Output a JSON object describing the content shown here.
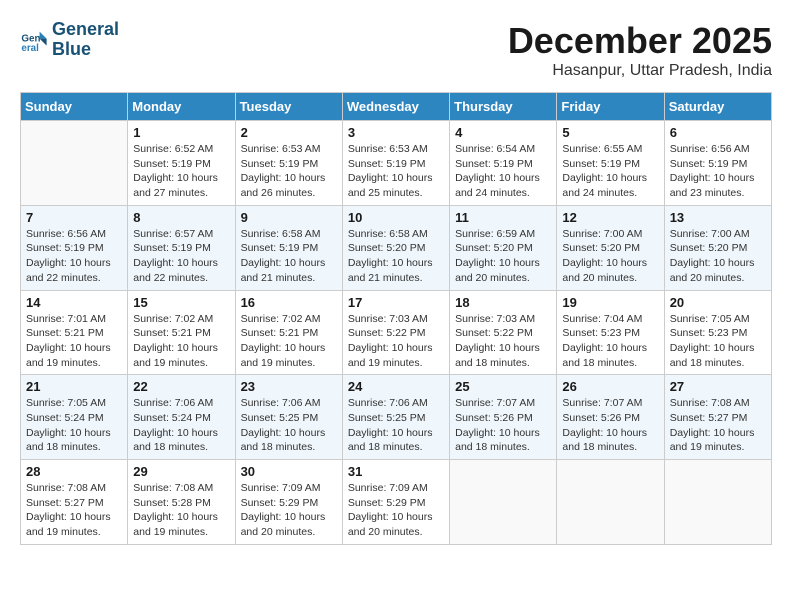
{
  "logo": {
    "line1": "General",
    "line2": "Blue"
  },
  "title": "December 2025",
  "subtitle": "Hasanpur, Uttar Pradesh, India",
  "days_of_week": [
    "Sunday",
    "Monday",
    "Tuesday",
    "Wednesday",
    "Thursday",
    "Friday",
    "Saturday"
  ],
  "weeks": [
    [
      {
        "day": "",
        "detail": ""
      },
      {
        "day": "1",
        "detail": "Sunrise: 6:52 AM\nSunset: 5:19 PM\nDaylight: 10 hours\nand 27 minutes."
      },
      {
        "day": "2",
        "detail": "Sunrise: 6:53 AM\nSunset: 5:19 PM\nDaylight: 10 hours\nand 26 minutes."
      },
      {
        "day": "3",
        "detail": "Sunrise: 6:53 AM\nSunset: 5:19 PM\nDaylight: 10 hours\nand 25 minutes."
      },
      {
        "day": "4",
        "detail": "Sunrise: 6:54 AM\nSunset: 5:19 PM\nDaylight: 10 hours\nand 24 minutes."
      },
      {
        "day": "5",
        "detail": "Sunrise: 6:55 AM\nSunset: 5:19 PM\nDaylight: 10 hours\nand 24 minutes."
      },
      {
        "day": "6",
        "detail": "Sunrise: 6:56 AM\nSunset: 5:19 PM\nDaylight: 10 hours\nand 23 minutes."
      }
    ],
    [
      {
        "day": "7",
        "detail": "Sunrise: 6:56 AM\nSunset: 5:19 PM\nDaylight: 10 hours\nand 22 minutes."
      },
      {
        "day": "8",
        "detail": "Sunrise: 6:57 AM\nSunset: 5:19 PM\nDaylight: 10 hours\nand 22 minutes."
      },
      {
        "day": "9",
        "detail": "Sunrise: 6:58 AM\nSunset: 5:19 PM\nDaylight: 10 hours\nand 21 minutes."
      },
      {
        "day": "10",
        "detail": "Sunrise: 6:58 AM\nSunset: 5:20 PM\nDaylight: 10 hours\nand 21 minutes."
      },
      {
        "day": "11",
        "detail": "Sunrise: 6:59 AM\nSunset: 5:20 PM\nDaylight: 10 hours\nand 20 minutes."
      },
      {
        "day": "12",
        "detail": "Sunrise: 7:00 AM\nSunset: 5:20 PM\nDaylight: 10 hours\nand 20 minutes."
      },
      {
        "day": "13",
        "detail": "Sunrise: 7:00 AM\nSunset: 5:20 PM\nDaylight: 10 hours\nand 20 minutes."
      }
    ],
    [
      {
        "day": "14",
        "detail": "Sunrise: 7:01 AM\nSunset: 5:21 PM\nDaylight: 10 hours\nand 19 minutes."
      },
      {
        "day": "15",
        "detail": "Sunrise: 7:02 AM\nSunset: 5:21 PM\nDaylight: 10 hours\nand 19 minutes."
      },
      {
        "day": "16",
        "detail": "Sunrise: 7:02 AM\nSunset: 5:21 PM\nDaylight: 10 hours\nand 19 minutes."
      },
      {
        "day": "17",
        "detail": "Sunrise: 7:03 AM\nSunset: 5:22 PM\nDaylight: 10 hours\nand 19 minutes."
      },
      {
        "day": "18",
        "detail": "Sunrise: 7:03 AM\nSunset: 5:22 PM\nDaylight: 10 hours\nand 18 minutes."
      },
      {
        "day": "19",
        "detail": "Sunrise: 7:04 AM\nSunset: 5:23 PM\nDaylight: 10 hours\nand 18 minutes."
      },
      {
        "day": "20",
        "detail": "Sunrise: 7:05 AM\nSunset: 5:23 PM\nDaylight: 10 hours\nand 18 minutes."
      }
    ],
    [
      {
        "day": "21",
        "detail": "Sunrise: 7:05 AM\nSunset: 5:24 PM\nDaylight: 10 hours\nand 18 minutes."
      },
      {
        "day": "22",
        "detail": "Sunrise: 7:06 AM\nSunset: 5:24 PM\nDaylight: 10 hours\nand 18 minutes."
      },
      {
        "day": "23",
        "detail": "Sunrise: 7:06 AM\nSunset: 5:25 PM\nDaylight: 10 hours\nand 18 minutes."
      },
      {
        "day": "24",
        "detail": "Sunrise: 7:06 AM\nSunset: 5:25 PM\nDaylight: 10 hours\nand 18 minutes."
      },
      {
        "day": "25",
        "detail": "Sunrise: 7:07 AM\nSunset: 5:26 PM\nDaylight: 10 hours\nand 18 minutes."
      },
      {
        "day": "26",
        "detail": "Sunrise: 7:07 AM\nSunset: 5:26 PM\nDaylight: 10 hours\nand 18 minutes."
      },
      {
        "day": "27",
        "detail": "Sunrise: 7:08 AM\nSunset: 5:27 PM\nDaylight: 10 hours\nand 19 minutes."
      }
    ],
    [
      {
        "day": "28",
        "detail": "Sunrise: 7:08 AM\nSunset: 5:27 PM\nDaylight: 10 hours\nand 19 minutes."
      },
      {
        "day": "29",
        "detail": "Sunrise: 7:08 AM\nSunset: 5:28 PM\nDaylight: 10 hours\nand 19 minutes."
      },
      {
        "day": "30",
        "detail": "Sunrise: 7:09 AM\nSunset: 5:29 PM\nDaylight: 10 hours\nand 20 minutes."
      },
      {
        "day": "31",
        "detail": "Sunrise: 7:09 AM\nSunset: 5:29 PM\nDaylight: 10 hours\nand 20 minutes."
      },
      {
        "day": "",
        "detail": ""
      },
      {
        "day": "",
        "detail": ""
      },
      {
        "day": "",
        "detail": ""
      }
    ]
  ]
}
